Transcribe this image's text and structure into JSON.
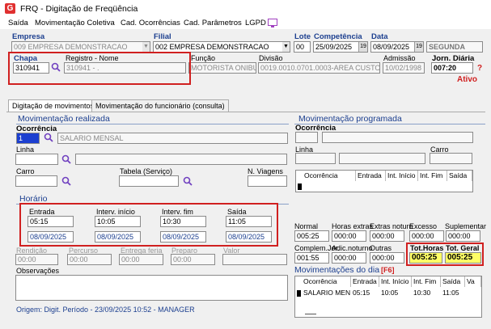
{
  "window": {
    "title": "FRQ - Digitação de Freqüência"
  },
  "menu": [
    "Saída",
    "Movimentação Coletiva",
    "Cad. Ocorrências",
    "Cad. Parâmetros",
    "LGPD"
  ],
  "header": {
    "empresa_label": "Empresa",
    "empresa_value": "009 EMPRESA DEMONSTRACAO",
    "filial_label": "Filial",
    "filial_value": "002 EMPRESA DEMONSTRACAO",
    "lote_label": "Lote",
    "lote_value": "00",
    "competencia_label": "Competência",
    "competencia_value": "25/09/2025",
    "data_label": "Data",
    "data_value": "08/09/2025",
    "weekday": "SEGUNDA",
    "chapa_label": "Chapa",
    "chapa_value": "310941",
    "registro_label": "Registro - Nome",
    "registro_value": "310941 - .",
    "funcao_label": "Função",
    "funcao_value": "MOTORISTA ONIBU",
    "divisao_label": "Divisão",
    "divisao_value": "0019.0010.0701.0003-AREA CUSTO MI",
    "admissao_label": "Admissão",
    "admissao_value": "10/02/1998",
    "jornada_label": "Jorn. Diária",
    "jornada_value": "007:20",
    "status": "Ativo",
    "help": "?",
    "cal_icon": "19"
  },
  "tabs": [
    "Digitação de movimentos",
    "Movimentação do funcionário (consulta)"
  ],
  "mov_realizada": {
    "title": "Movimentação realizada",
    "ocorrencia_label": "Ocorrência",
    "ocorrencia_code": "1",
    "ocorrencia_desc": "SALARIO MENSAL",
    "linha_label": "Linha",
    "carro_label": "Carro",
    "tabela_label": "Tabela (Serviço)",
    "viagens_label": "N. Viagens",
    "horario_title": "Horário",
    "entrada_label": "Entrada",
    "entrada_time": "05:15",
    "entrada_date": "08/09/2025",
    "int_inicio_label": "Interv. início",
    "int_inicio_time": "10:05",
    "int_inicio_date": "08/09/2025",
    "int_fim_label": "Interv. fim",
    "int_fim_time": "10:30",
    "int_fim_date": "08/09/2025",
    "saida_label": "Saída",
    "saida_time": "11:05",
    "saida_date": "08/09/2025",
    "rendicao_label": "Rendição",
    "rendicao_value": "00:00",
    "percurso_label": "Percurso",
    "percurso_value": "00:00",
    "entrega_label": "Entrega feria",
    "entrega_value": "00:00",
    "preparo_label": "Preparo",
    "preparo_value": "00:00",
    "valor_label": "Valor",
    "obs_label": "Observações",
    "origem": "Origem: Digit. Período - 23/09/2025 10:52 - MANAGER"
  },
  "mov_programada": {
    "title": "Movimentação programada",
    "ocorrencia_label": "Ocorrência",
    "linha_label": "Linha",
    "carro_label": "Carro",
    "grid_headers": [
      "Ocorrência",
      "Entrada",
      "Int. Início",
      "Int. Fim",
      "Saída"
    ]
  },
  "totals": {
    "normal_label": "Normal",
    "normal_value": "005:25",
    "horas_extras_label": "Horas extras",
    "horas_extras_value": "000:00",
    "extras_noturn_label": "Extras noturn",
    "extras_noturn_value": "000:00",
    "excesso_label": "Excesso",
    "excesso_value": "000:00",
    "suplementar_label": "Suplementar",
    "suplementar_value": "000:00",
    "complem_label": "Complem.Jor.",
    "complem_value": "001:55",
    "adic_noturno_label": "Adic.noturno",
    "adic_noturno_value": "000:00",
    "outras_label": "Outras",
    "outras_value": "000:00",
    "tot_horas_label": "Tot.Horas",
    "tot_horas_value": "005:25",
    "tot_geral_label": "Tot. Geral",
    "tot_geral_value": "005:25"
  },
  "mov_dia": {
    "title": "Movimentações do dia",
    "hotkey": "[F6]",
    "headers": [
      "Ocorrência",
      "Entrada",
      "Int. Início",
      "Int. Fim",
      "Saída",
      "Va"
    ],
    "rows": [
      [
        "SALARIO MEN",
        "05:15",
        "10:05",
        "10:30",
        "11:05",
        ""
      ]
    ]
  }
}
